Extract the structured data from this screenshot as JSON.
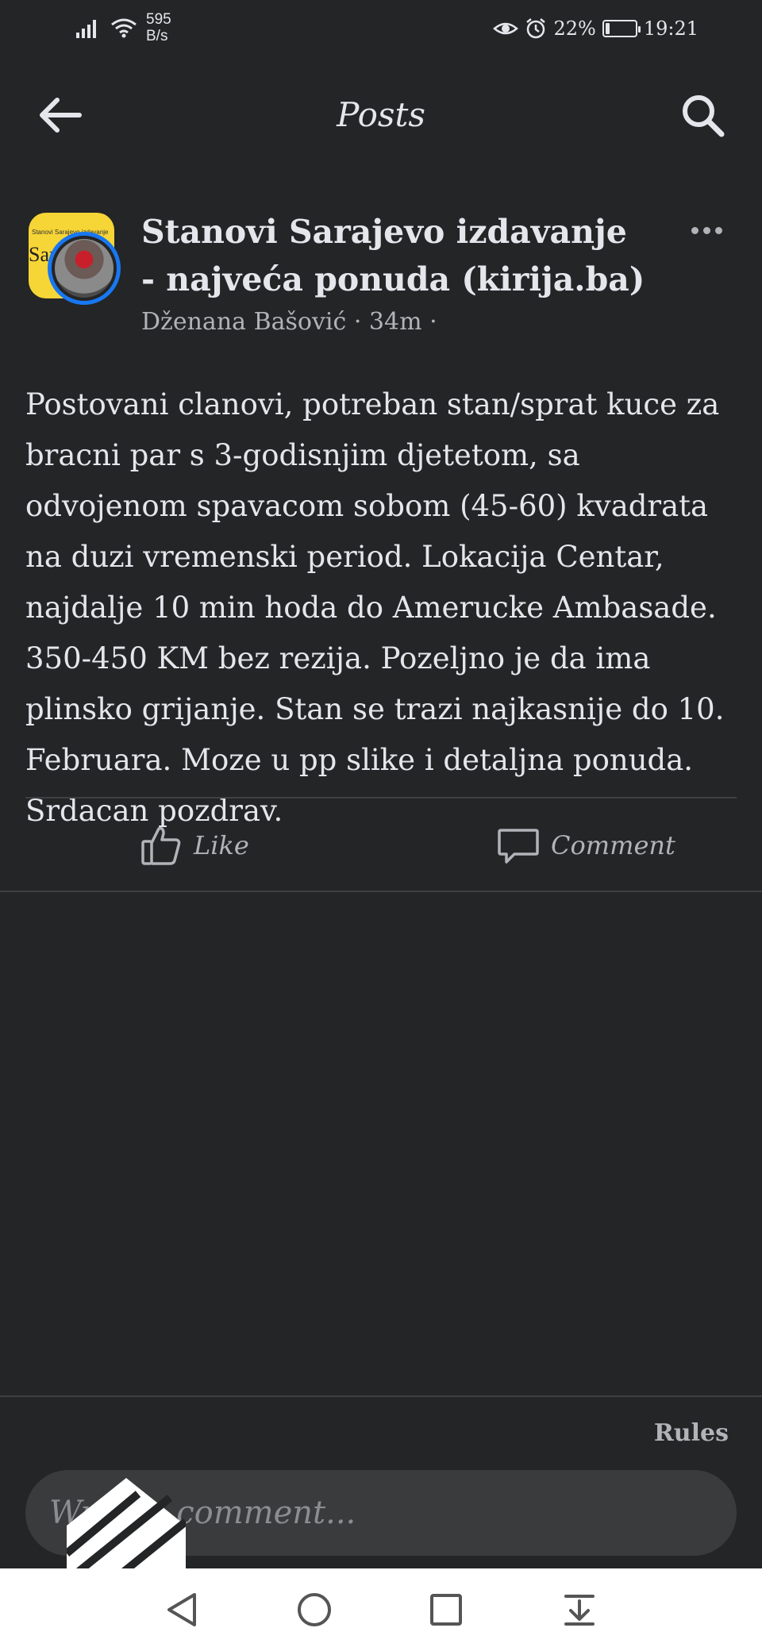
{
  "status_bar": {
    "net_speed_value": "595",
    "net_speed_unit": "B/s",
    "battery": "22%",
    "battery_level": 0.22,
    "time": "19:21"
  },
  "header": {
    "title": "Posts",
    "back_icon": "arrow-left-icon",
    "search_icon": "search-icon"
  },
  "post": {
    "group_name": "Stanovi Sarajevo izdavanje - najveća ponuda (kirija.ba)",
    "author": "Dženana Bašović",
    "time": "34m",
    "group_avatar_caption": "Stanovi Sarajevo izdavanje",
    "group_avatar_text": "Sar",
    "body": "Postovani clanovi, potreban stan/sprat kuce za bracni par s 3-godisnjim djetetom, sa odvojenom spavacom sobom (45-60) kvadrata na duzi vremenski period. Lokacija Centar, najdalje 10 min hoda do Amerucke Ambasade. 350-450 KM bez rezija. Pozeljno je da ima plinsko grijanje. Stan se trazi najkasnije do 10. Februara. Moze u pp slike i detaljna ponuda. Srdacan pozdrav.",
    "actions": {
      "like_label": "Like",
      "comment_label": "Comment"
    }
  },
  "footer": {
    "rules_label": "Rules",
    "comment_placeholder": "Write a comment..."
  },
  "colors": {
    "background": "#242526",
    "text": "#e4e6eb",
    "muted": "#b0b3b8",
    "input_bg": "#3a3b3c",
    "accent": "#1877f2",
    "group_avatar": "#f6d536"
  }
}
